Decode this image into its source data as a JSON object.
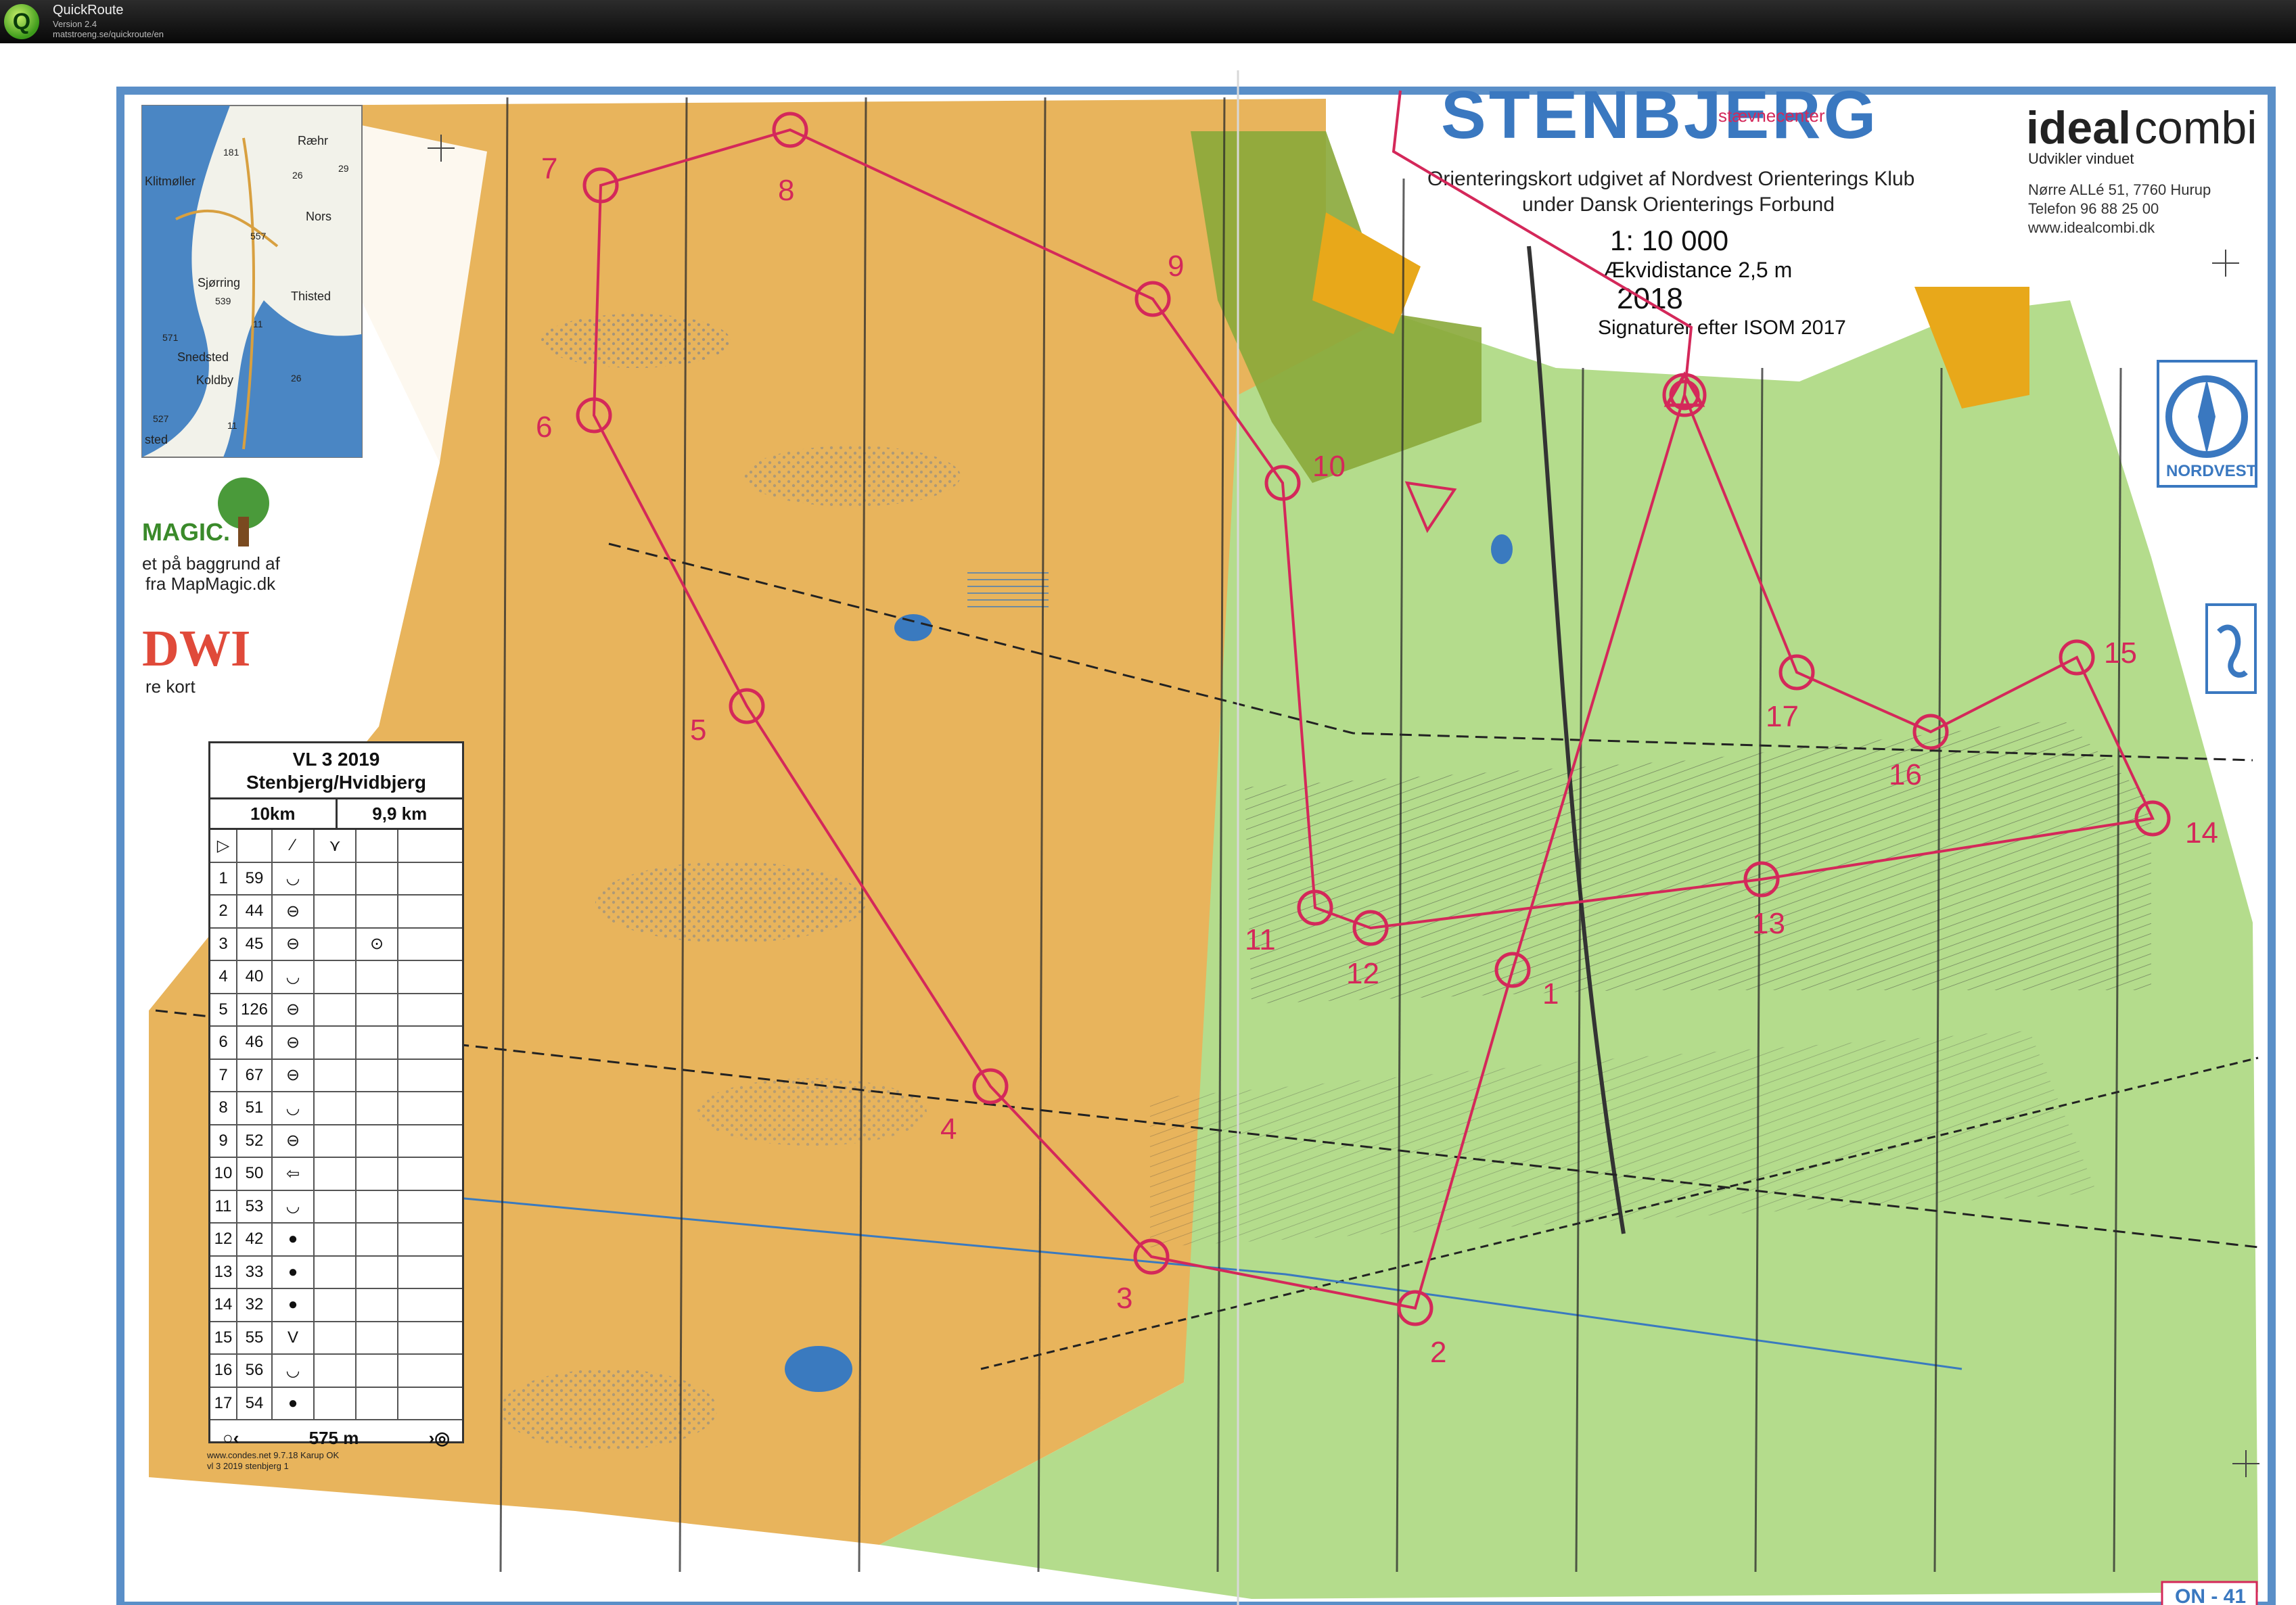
{
  "window": {
    "app_name": "QuickRoute",
    "version": "Version 2.4",
    "url": "matstroeng.se/quickroute/en",
    "icon_letter": "Q"
  },
  "map": {
    "title": "STENBJERG",
    "event_center": "stævnecenter",
    "publisher_line1": "Orienteringskort udgivet af Nordvest Orienterings Klub",
    "publisher_line2": "under Dansk Orienterings Forbund",
    "scale": "1: 10 000",
    "contour": "Ækvidistance 2,5 m",
    "year": "2018",
    "symbols": "Signaturer efter ISOM 2017",
    "sponsor_name_a": "ideal",
    "sponsor_name_b": "combi",
    "sponsor_tagline": "Udvikler vinduet",
    "sponsor_addr": "Nørre ALLé 51, 7760 Hurup",
    "sponsor_phone": "Telefon 96 88 25 00",
    "sponsor_web": "www.idealcombi.dk",
    "club_label": "NORDVEST",
    "magic_logo": "MAGIC.",
    "magic_text1": "et på baggrund af",
    "magic_text2": "fra MapMagic.dk",
    "dwi_logo": "DWI",
    "dwi_text": "re kort",
    "map_number": "ON - 41",
    "footer1": "www.condes.net 9.7.18 Karup OK",
    "footer2": "vl 3 2019 stenbjerg 1",
    "inset_places": [
      "Ræhr",
      "Klitmøller",
      "Nors",
      "Sjørring",
      "Thisted",
      "Snedsted",
      "Koldby",
      "sted"
    ],
    "inset_roads": [
      "181",
      "26",
      "29",
      "557",
      "539",
      "571",
      "11",
      "26",
      "527",
      "11"
    ],
    "colors": {
      "open_land": "#e8b45c",
      "forest": "#b4dc8c",
      "course": "#d4285a",
      "frame": "#5a8fc8",
      "settlement": "#8aa83a"
    }
  },
  "controls": [
    {
      "label": "1"
    },
    {
      "label": "2"
    },
    {
      "label": "3"
    },
    {
      "label": "4"
    },
    {
      "label": "5"
    },
    {
      "label": "6"
    },
    {
      "label": "7"
    },
    {
      "label": "8"
    },
    {
      "label": "9"
    },
    {
      "label": "10"
    },
    {
      "label": "11"
    },
    {
      "label": "12"
    },
    {
      "label": "13"
    },
    {
      "label": "14"
    },
    {
      "label": "15"
    },
    {
      "label": "16"
    },
    {
      "label": "17"
    }
  ],
  "description": {
    "title": "VL 3 2019",
    "subtitle": "Stenbjerg/Hvidbjerg",
    "class": "10km",
    "length": "9,9 km",
    "rows": [
      {
        "n": "1",
        "code": "59",
        "sym": "◡",
        "extra": ""
      },
      {
        "n": "2",
        "code": "44",
        "sym": "⊖",
        "extra": ""
      },
      {
        "n": "3",
        "code": "45",
        "sym": "⊖",
        "extra": "⊙"
      },
      {
        "n": "4",
        "code": "40",
        "sym": "◡",
        "extra": ""
      },
      {
        "n": "5",
        "code": "126",
        "sym": "⊖",
        "extra": ""
      },
      {
        "n": "6",
        "code": "46",
        "sym": "⊖",
        "extra": ""
      },
      {
        "n": "7",
        "code": "67",
        "sym": "⊖",
        "extra": ""
      },
      {
        "n": "8",
        "code": "51",
        "sym": "◡",
        "extra": ""
      },
      {
        "n": "9",
        "code": "52",
        "sym": "⊖",
        "extra": ""
      },
      {
        "n": "10",
        "code": "50",
        "sym": "⇦",
        "extra": ""
      },
      {
        "n": "11",
        "code": "53",
        "sym": "◡",
        "extra": ""
      },
      {
        "n": "12",
        "code": "42",
        "sym": "●",
        "extra": ""
      },
      {
        "n": "13",
        "code": "33",
        "sym": "●",
        "extra": ""
      },
      {
        "n": "14",
        "code": "32",
        "sym": "●",
        "extra": ""
      },
      {
        "n": "15",
        "code": "55",
        "sym": "V",
        "extra": ""
      },
      {
        "n": "16",
        "code": "56",
        "sym": "◡",
        "extra": ""
      },
      {
        "n": "17",
        "code": "54",
        "sym": "●",
        "extra": ""
      }
    ],
    "finish_distance": "575 m"
  }
}
